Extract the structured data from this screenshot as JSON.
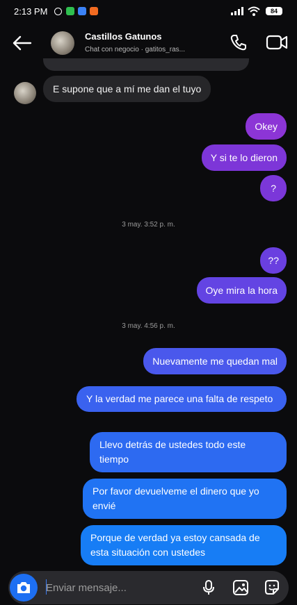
{
  "status_bar": {
    "time": "2:13 PM",
    "battery": "84"
  },
  "header": {
    "title": "Castillos Gatunos",
    "subtitle": "Chat con negocio · gatitos_ras..."
  },
  "messages": [
    {
      "direction": "in",
      "text": "E supone que a mí me dan el tuyo"
    },
    {
      "direction": "out",
      "text": "Okey",
      "color": "#8c35d6"
    },
    {
      "direction": "out",
      "text": "Y si te lo dieron",
      "color": "#7d36d8"
    },
    {
      "direction": "out",
      "text": "?",
      "color": "#7b37d9"
    }
  ],
  "timestamp_1": "3 may. 3:52 p. m.",
  "messages_2": [
    {
      "direction": "out",
      "text": "??",
      "color": "#6a3fe0"
    },
    {
      "direction": "out",
      "text": "Oye mira la hora",
      "color": "#6344e3"
    }
  ],
  "timestamp_2": "3 may. 4:56 p. m.",
  "messages_3": [
    {
      "direction": "out",
      "text": "Nuevamente me quedan mal",
      "color": "#4a58ec"
    },
    {
      "direction": "out",
      "text": "Y la verdad me parece una falta de respeto",
      "color": "#3a62ef"
    },
    {
      "direction": "out",
      "text": "Llevo detrás de ustedes todo este tiempo",
      "color": "#2d6af1"
    },
    {
      "direction": "out",
      "text": "Por favor devuelveme el dinero que yo envié",
      "color": "#2073f3"
    },
    {
      "direction": "out",
      "text": "Porque de verdad ya estoy cansada de esta situación con ustedes",
      "color": "#177df5"
    }
  ],
  "composer": {
    "placeholder": "Enviar mensaje..."
  },
  "colors": {
    "background": "#0b0b0d",
    "incoming_bubble": "#262629",
    "accent": "#1d6ff2"
  }
}
